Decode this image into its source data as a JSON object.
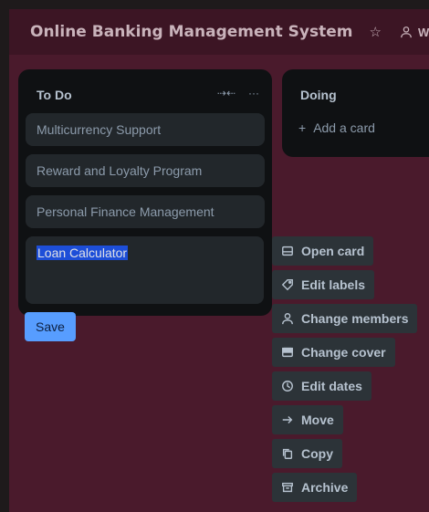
{
  "header": {
    "board_title": "Online Banking Management System",
    "workspace_label": "Wor"
  },
  "lists": {
    "todo": {
      "title": "To Do",
      "cards": [
        "Multicurrency Support",
        "Reward and Loyalty Program",
        "Personal Finance Management"
      ]
    },
    "doing": {
      "title": "Doing",
      "add_card_label": "Add a card"
    }
  },
  "editor": {
    "value": "Loan Calculator",
    "save_label": "Save"
  },
  "card_menu": {
    "open_card": "Open card",
    "edit_labels": "Edit labels",
    "change_members": "Change members",
    "change_cover": "Change cover",
    "edit_dates": "Edit dates",
    "move": "Move",
    "copy": "Copy",
    "archive": "Archive"
  },
  "colors": {
    "board_bg": "#4a1a2c",
    "list_bg": "#0f1113",
    "card_bg": "#22272b",
    "save_btn": "#579dff",
    "selection": "#1d4ed8"
  }
}
